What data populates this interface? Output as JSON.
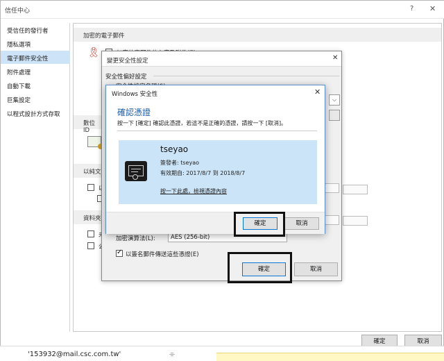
{
  "trust_center": {
    "title": "信任中心",
    "help": "?",
    "close": "✕",
    "sidebar": [
      {
        "label": "受信任的發行者",
        "selected": false
      },
      {
        "label": "隱私選項",
        "selected": false
      },
      {
        "label": "電子郵件安全性",
        "selected": true
      },
      {
        "label": "附件處理",
        "selected": false
      },
      {
        "label": "自動下載",
        "selected": false
      },
      {
        "label": "巨集設定",
        "selected": false
      },
      {
        "label": "以程式設計方式存取",
        "selected": false
      }
    ],
    "content": {
      "encrypted_header": "加密的電子郵件",
      "encrypt_option_peek": "加密外寄郵件的內容及附件(E)",
      "digital_id_header_peek": "數位 ID",
      "plaintext_header_peek": "以純文",
      "plaintext_option_peek": "以",
      "folders_header_peek": "資料夾",
      "folders_option1_peek": "未",
      "folders_option2_peek": "公"
    },
    "buttons": {
      "ok": "確定",
      "cancel": "取消"
    }
  },
  "change_security_dialog": {
    "title": "變更安全性設定",
    "close": "✕",
    "group_label": "安全性偏好設定",
    "hidden_row_peek": "安全性設定名稱(S):",
    "dropdown_arrow": "⌵",
    "algorithm_label": "加密演算法(L):",
    "algorithm_value": "AES (256-bit)",
    "send_certs_label": "以簽名郵件傳送這些憑證(E)",
    "send_certs_checked": true,
    "buttons": {
      "ok": "確定",
      "cancel": "取消"
    }
  },
  "windows_security_dialog": {
    "title": "Windows 安全性",
    "close": "✕",
    "heading": "確認憑證",
    "instruction": "按一下 [確定] 確認此憑證，若這不是正確的憑證，請按一下 [取消]。",
    "certificate": {
      "name": "tseyao",
      "issuer": "簽發者: tseyao",
      "validity": "有效期自: 2017/8/7 到 2018/8/7",
      "link": "按一下此處，檢視憑證內容"
    },
    "buttons": {
      "ok": "確定",
      "cancel": "取消"
    }
  },
  "status_bar": {
    "email": "'153932@mail.csc.com.tw'",
    "clip_icon": "paperclip-icon"
  }
}
